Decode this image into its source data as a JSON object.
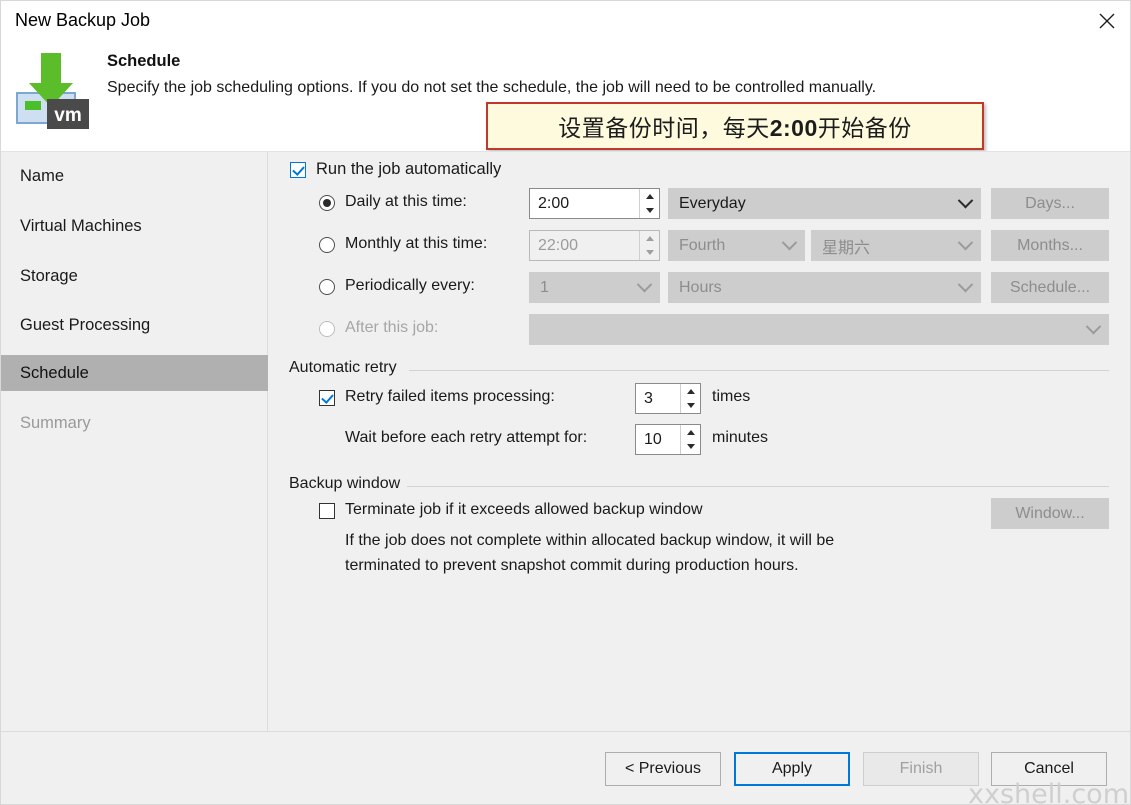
{
  "window": {
    "title": "New Backup Job",
    "close_icon": "close-icon"
  },
  "header": {
    "title": "Schedule",
    "description": "Specify the job scheduling options. If you do not set the schedule, the job will need to be controlled manually.",
    "icon": "vm-backup-icon"
  },
  "annotation": {
    "text_before": "设置备份时间，每天",
    "text_bold": "2:00",
    "text_after": "开始备份",
    "full_text": "设置备份时间，每天2:00开始备份",
    "border_color": "#c0392b",
    "background_color": "#fdfade"
  },
  "sidebar": {
    "items": [
      {
        "label": "Name",
        "state": "normal"
      },
      {
        "label": "Virtual Machines",
        "state": "normal"
      },
      {
        "label": "Storage",
        "state": "normal"
      },
      {
        "label": "Guest Processing",
        "state": "normal"
      },
      {
        "label": "Schedule",
        "state": "selected"
      },
      {
        "label": "Summary",
        "state": "disabled"
      }
    ],
    "selected_color": "#b0b0b0"
  },
  "schedule": {
    "run_automatically": {
      "label": "Run the job automatically",
      "checked": true
    },
    "rows": [
      {
        "radio_label": "Daily at this time:",
        "selected": true,
        "time_value": "2:00",
        "combo_value": "Everyday",
        "button_label": "Days..."
      },
      {
        "radio_label": "Monthly at this time:",
        "selected": false,
        "time_value": "22:00",
        "combo_value": "Fourth",
        "combo2_value": "星期六",
        "button_label": "Months..."
      },
      {
        "radio_label": "Periodically every:",
        "selected": false,
        "count_value": "1",
        "combo_value": "Hours",
        "button_label": "Schedule..."
      },
      {
        "radio_label": "After this job:",
        "selected": false,
        "combo_value": ""
      }
    ]
  },
  "automatic_retry": {
    "group_label": "Automatic retry",
    "retry_checkbox_label": "Retry failed items processing:",
    "retry_checked": true,
    "retry_times_value": "3",
    "retry_times_unit": "times",
    "wait_label": "Wait before each retry attempt for:",
    "wait_value": "10",
    "wait_unit": "minutes"
  },
  "backup_window": {
    "group_label": "Backup window",
    "terminate_label": "Terminate job if it exceeds allowed backup window",
    "terminate_checked": false,
    "window_button_label": "Window...",
    "description_line1": "If the job does not complete within allocated backup window, it will be",
    "description_line2": "terminated to prevent snapshot commit during production hours."
  },
  "footer": {
    "previous_label": "< Previous",
    "apply_label": "Apply",
    "finish_label": "Finish",
    "cancel_label": "Cancel",
    "accent_color": "#0078d7"
  },
  "watermark": {
    "text": "xxshell.com"
  }
}
